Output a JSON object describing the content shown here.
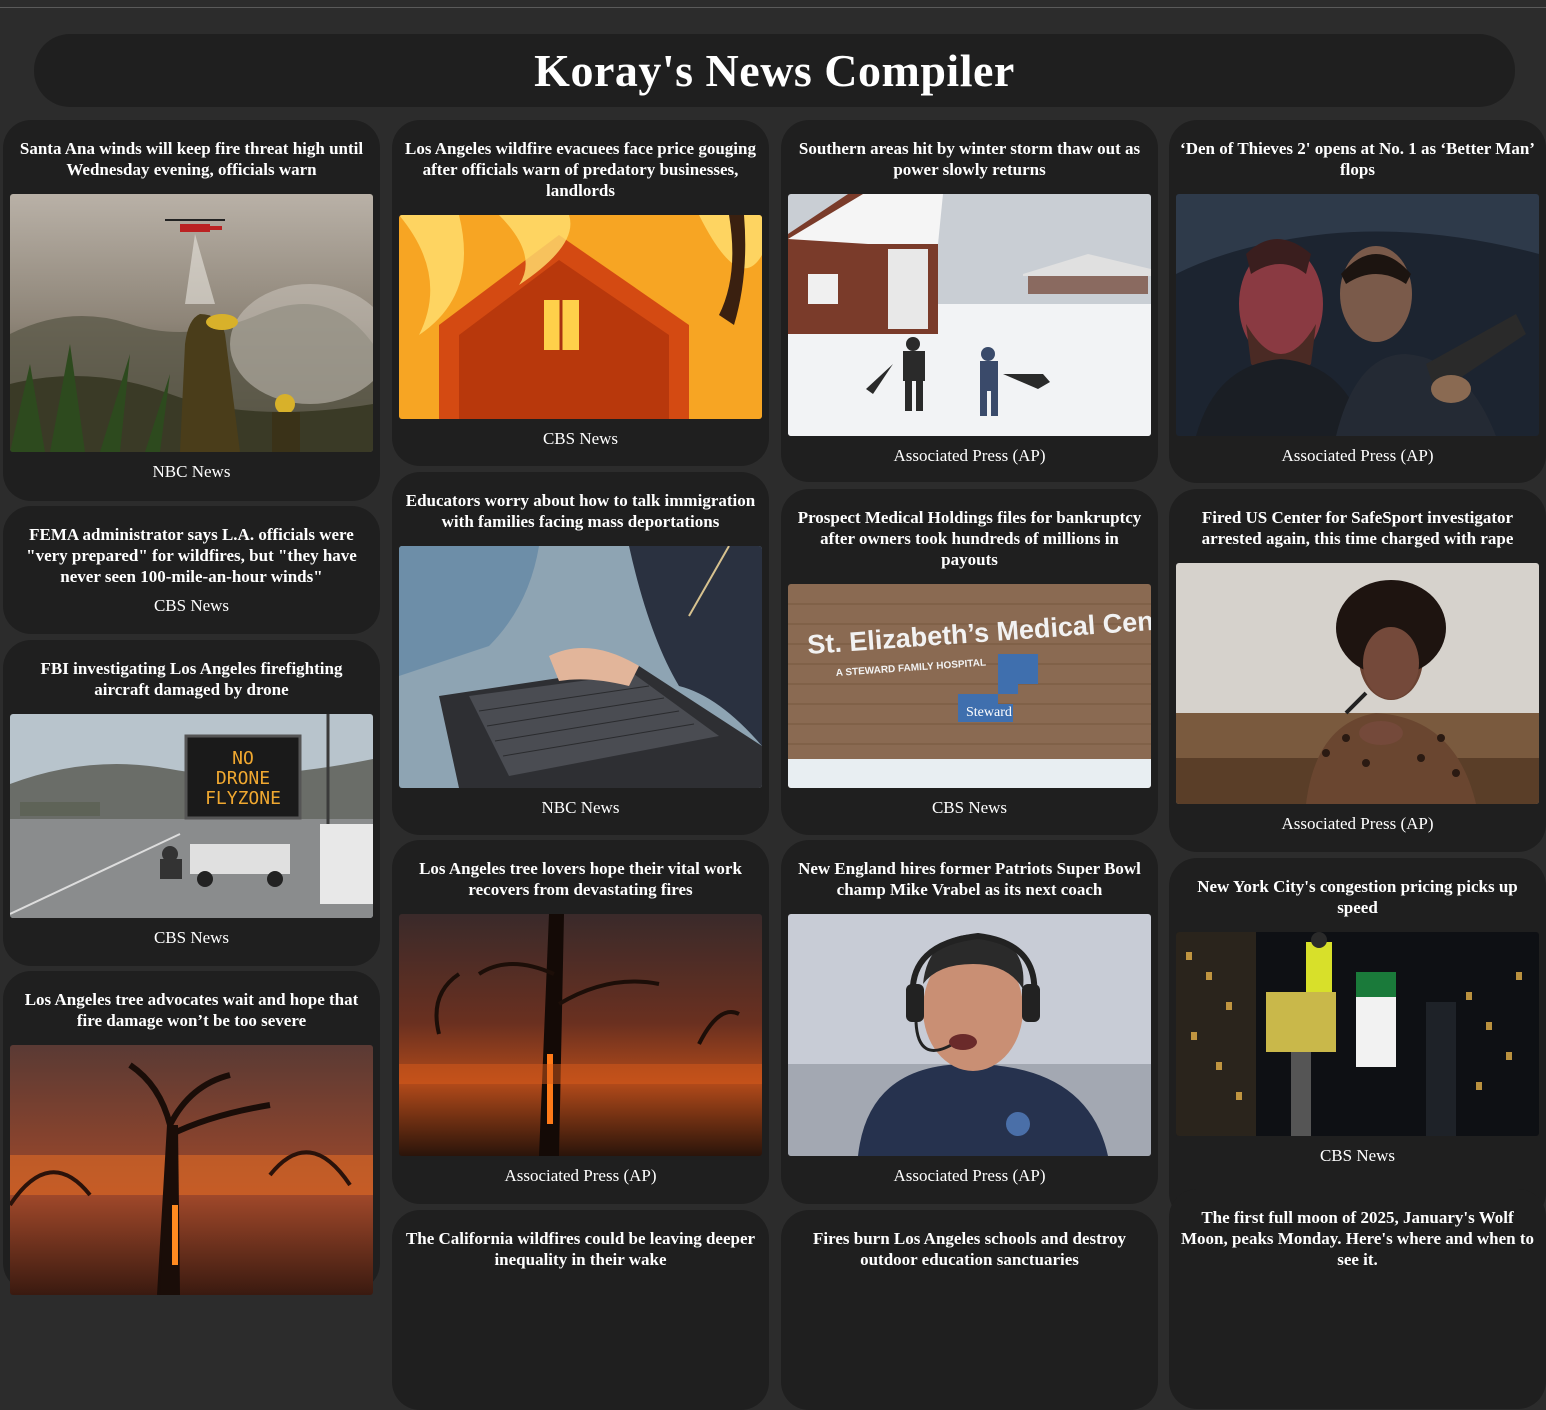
{
  "app_title": "Koray's News Compiler",
  "columns": [
    [
      {
        "title": "Santa Ana winds will keep fire threat high until Wednesday evening, officials warn",
        "source": "NBC News",
        "image": "firefighter-helicopter-photo"
      },
      {
        "title": "FEMA administrator says L.A. officials were \"very prepared\" for wildfires, but \"they have never seen 100-mile-an-hour winds\"",
        "source": "CBS News",
        "image": ""
      },
      {
        "title": "FBI investigating Los Angeles firefighting aircraft damaged by drone",
        "source": "CBS News",
        "image": "no-drone-sign-photo"
      },
      {
        "title": "Los Angeles tree advocates wait and hope that fire damage won’t be too severe",
        "source": "",
        "image": "burning-trees-photo"
      }
    ],
    [
      {
        "title": "Los Angeles wildfire evacuees face price gouging after officials warn of predatory businesses, landlords",
        "source": "CBS News",
        "image": "burning-house-photo"
      },
      {
        "title": "Educators worry about how to talk immigration with families facing mass deportations",
        "source": "NBC News",
        "image": "laptop-photo"
      },
      {
        "title": "Los Angeles tree lovers hope their vital work recovers from devastating fires",
        "source": "Associated Press (AP)",
        "image": "burned-tree-photo"
      },
      {
        "title": "The California wildfires could be leaving deeper inequality in their wake",
        "source": "",
        "image": ""
      }
    ],
    [
      {
        "title": "Southern areas hit by winter storm thaw out as power slowly returns",
        "source": "Associated Press (AP)",
        "image": "snow-shoveling-photo"
      },
      {
        "title": "Prospect Medical Holdings files for bankruptcy after owners took hundreds of millions in payouts",
        "source": "CBS News",
        "image": "hospital-sign-photo",
        "sign": {
          "main": "St. Elizabeth’s Medical Center",
          "sub": "A STEWARD FAMILY HOSPITAL",
          "logo": "Steward"
        }
      },
      {
        "title": "New England hires former Patriots Super Bowl champ Mike Vrabel as its next coach",
        "source": "Associated Press (AP)",
        "image": "coach-headset-photo"
      },
      {
        "title": "Fires burn Los Angeles schools and destroy outdoor education sanctuaries",
        "source": "",
        "image": ""
      }
    ],
    [
      {
        "title": "‘Den of Thieves 2' opens at No. 1 as ‘Better Man’ flops",
        "source": "Associated Press (AP)",
        "image": "movie-still-photo"
      },
      {
        "title": "Fired US Center for SafeSport investigator arrested again, this time charged with rape",
        "source": "Associated Press (AP)",
        "image": "testimony-photo"
      },
      {
        "title": "New York City's congestion pricing picks up speed",
        "source": "CBS News",
        "image": "congestion-sign-photo"
      },
      {
        "title": "The first full moon of 2025, January's Wolf Moon, peaks Monday. Here's where and when to see it.",
        "source": "",
        "image": ""
      }
    ]
  ],
  "colors": {
    "page_bg": "#2c2c2c",
    "card_bg": "#1f1f1f",
    "text": "#ffffff"
  }
}
